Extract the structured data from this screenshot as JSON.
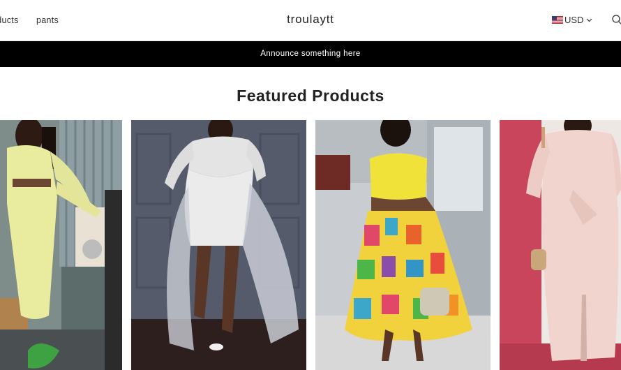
{
  "header": {
    "nav": [
      {
        "label": "oducts"
      },
      {
        "label": "pants"
      }
    ],
    "logo": "troulaytt",
    "currency": "USD"
  },
  "announcement": "Announce something here",
  "featured": {
    "title": "Featured Products"
  },
  "icons": {
    "flag": "us-flag-icon",
    "currency_chevron": "chevron-down-icon",
    "search": "search-icon"
  }
}
